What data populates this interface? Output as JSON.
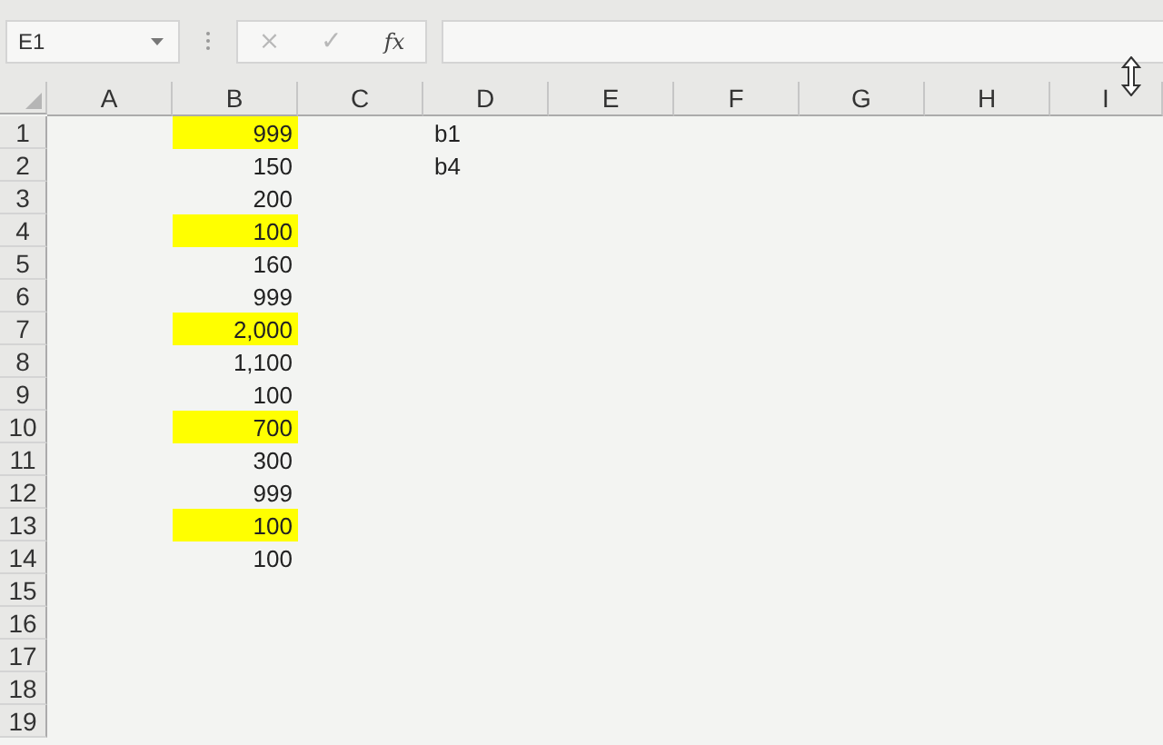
{
  "name_box": {
    "value": "E1"
  },
  "formula_buttons": [
    {
      "kind": "cancel",
      "label": "×",
      "disabled": true
    },
    {
      "kind": "enter",
      "label": "✓",
      "disabled": true
    },
    {
      "kind": "function",
      "label": "fx",
      "disabled": false
    }
  ],
  "columns": [
    "A",
    "B",
    "C",
    "D",
    "E",
    "F",
    "G",
    "H",
    "I"
  ],
  "rows": [
    {
      "label": "1",
      "cells": [
        {},
        {
          "text": "999",
          "color": "#ffff00"
        },
        {},
        {
          "text": "b1"
        },
        {},
        {},
        {},
        {},
        {}
      ]
    },
    {
      "label": "2",
      "cells": [
        {},
        {
          "text": "150"
        },
        {},
        {
          "text": "b4"
        },
        {},
        {},
        {},
        {},
        {}
      ]
    },
    {
      "label": "3",
      "cells": [
        {},
        {
          "text": "200"
        },
        {},
        {},
        {},
        {},
        {},
        {},
        {}
      ]
    },
    {
      "label": "4",
      "cells": [
        {},
        {
          "text": "100",
          "color": "#ffff00"
        },
        {},
        {},
        {},
        {},
        {},
        {},
        {}
      ]
    },
    {
      "label": "5",
      "cells": [
        {},
        {
          "text": "160"
        },
        {},
        {},
        {},
        {},
        {},
        {},
        {}
      ]
    },
    {
      "label": "6",
      "cells": [
        {},
        {
          "text": "999"
        },
        {},
        {},
        {},
        {},
        {},
        {},
        {}
      ]
    },
    {
      "label": "7",
      "cells": [
        {},
        {
          "text": "2,000",
          "color": "#ffff00"
        },
        {},
        {},
        {},
        {},
        {},
        {},
        {}
      ]
    },
    {
      "label": "8",
      "cells": [
        {},
        {
          "text": "1,100"
        },
        {},
        {},
        {},
        {},
        {},
        {},
        {}
      ]
    },
    {
      "label": "9",
      "cells": [
        {},
        {
          "text": "100"
        },
        {},
        {},
        {},
        {},
        {},
        {},
        {}
      ]
    },
    {
      "label": "10",
      "cells": [
        {},
        {
          "text": "700",
          "color": "#ffff00"
        },
        {},
        {},
        {},
        {},
        {},
        {},
        {}
      ]
    },
    {
      "label": "11",
      "cells": [
        {},
        {
          "text": "300"
        },
        {},
        {},
        {},
        {},
        {},
        {},
        {}
      ]
    },
    {
      "label": "12",
      "cells": [
        {},
        {
          "text": "999"
        },
        {},
        {},
        {},
        {},
        {},
        {},
        {}
      ]
    },
    {
      "label": "13",
      "cells": [
        {},
        {
          "text": "100",
          "color": "#ffff00"
        },
        {},
        {},
        {},
        {},
        {},
        {},
        {}
      ]
    },
    {
      "label": "14",
      "cells": [
        {},
        {
          "text": "100"
        },
        {},
        {},
        {},
        {},
        {},
        {},
        {}
      ]
    },
    {
      "label": "15",
      "cells": [
        {},
        {},
        {},
        {},
        {},
        {},
        {},
        {},
        {}
      ]
    },
    {
      "label": "16",
      "cells": [
        {},
        {},
        {},
        {},
        {},
        {},
        {},
        {},
        {}
      ]
    },
    {
      "label": "17",
      "cells": [
        {},
        {},
        {},
        {},
        {},
        {},
        {},
        {},
        {}
      ]
    },
    {
      "label": "18",
      "cells": [
        {},
        {},
        {},
        {},
        {},
        {},
        {},
        {},
        {}
      ]
    },
    {
      "label": "19",
      "cells": [
        {},
        {},
        {},
        {},
        {},
        {},
        {},
        {},
        {}
      ]
    }
  ]
}
